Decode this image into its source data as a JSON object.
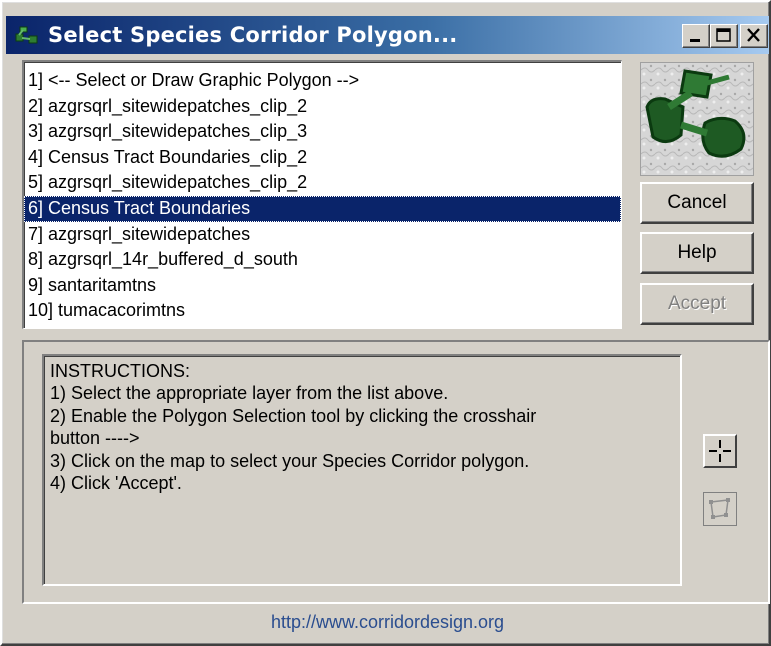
{
  "window": {
    "title": "Select Species Corridor Polygon...",
    "title_icon": "corridor-app-icon",
    "controls": [
      "minimize-icon",
      "maximize-icon",
      "close-icon"
    ]
  },
  "layers": {
    "items": [
      "1] <-- Select or Draw Graphic Polygon -->",
      "2] azgrsqrl_sitewidepatches_clip_2",
      "3] azgrsqrl_sitewidepatches_clip_3",
      "4] Census Tract Boundaries_clip_2",
      "5] azgrsqrl_sitewidepatches_clip_2",
      "6] Census Tract Boundaries",
      "7] azgrsqrl_sitewidepatches",
      "8] azgrsqrl_14r_buffered_d_south",
      "9] santaritamtns",
      "10] tumacacorimtns"
    ],
    "selected": "6] Census Tract Boundaries"
  },
  "buttons": {
    "cancel": "Cancel",
    "help": "Help",
    "accept": "Accept",
    "accept_enabled": false
  },
  "instructions": {
    "lines": [
      "INSTRUCTIONS:",
      "1) Select the appropriate layer from the list above.",
      "2) Enable the Polygon Selection tool by clicking the crosshair",
      "button ---->",
      "3) Click on the map to select your Species Corridor polygon.",
      "4) Click 'Accept'."
    ]
  },
  "tools": {
    "crosshair": "crosshair-icon",
    "polygon": "polygon-select-icon"
  },
  "footer": {
    "url": "http://www.corridordesign.org"
  },
  "colors": {
    "title_bar": "#0a246a",
    "selection": "#0a246a",
    "face": "#d4d0c8",
    "logo_green": "#1e5a23",
    "link": "#2a4d8f"
  }
}
